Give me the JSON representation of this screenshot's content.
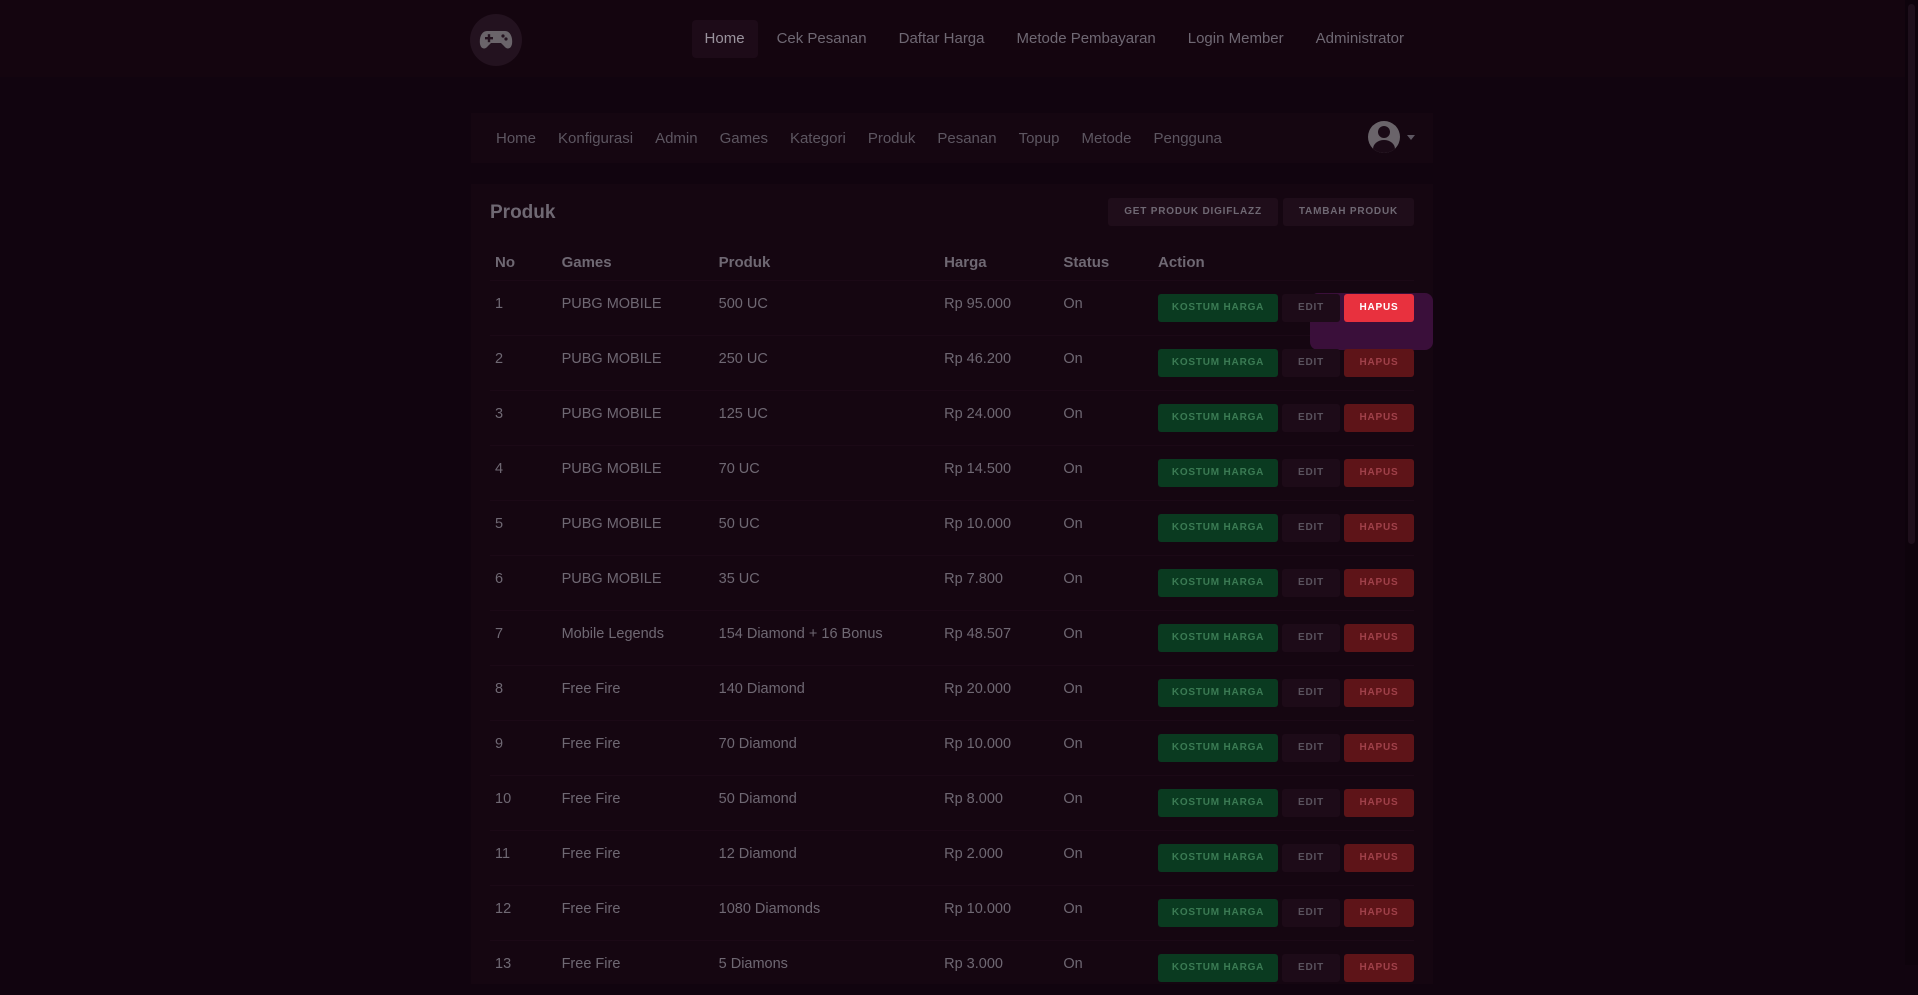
{
  "topnav": {
    "items": [
      "Home",
      "Cek Pesanan",
      "Daftar Harga",
      "Metode Pembayaran",
      "Login Member",
      "Administrator"
    ],
    "active": "Home"
  },
  "subnav": {
    "items": [
      "Home",
      "Konfigurasi",
      "Admin",
      "Games",
      "Kategori",
      "Produk",
      "Pesanan",
      "Topup",
      "Metode",
      "Pengguna"
    ]
  },
  "card": {
    "title": "Produk",
    "btn_get": "GET PRODUK DIGIFLAZZ",
    "btn_add": "TAMBAH PRODUK"
  },
  "table": {
    "headers": [
      "No",
      "Games",
      "Produk",
      "Harga",
      "Status",
      "Action"
    ],
    "action_labels": {
      "kostum": "KOSTUM HARGA",
      "edit": "EDIT",
      "hapus": "HAPUS"
    },
    "rows": [
      {
        "no": "1",
        "game": "PUBG MOBILE",
        "produk": "500 UC",
        "harga": "Rp 95.000",
        "status": "On"
      },
      {
        "no": "2",
        "game": "PUBG MOBILE",
        "produk": "250 UC",
        "harga": "Rp 46.200",
        "status": "On"
      },
      {
        "no": "3",
        "game": "PUBG MOBILE",
        "produk": "125 UC",
        "harga": "Rp 24.000",
        "status": "On"
      },
      {
        "no": "4",
        "game": "PUBG MOBILE",
        "produk": "70 UC",
        "harga": "Rp 14.500",
        "status": "On"
      },
      {
        "no": "5",
        "game": "PUBG MOBILE",
        "produk": "50 UC",
        "harga": "Rp 10.000",
        "status": "On"
      },
      {
        "no": "6",
        "game": "PUBG MOBILE",
        "produk": "35 UC",
        "harga": "Rp 7.800",
        "status": "On"
      },
      {
        "no": "7",
        "game": "Mobile Legends",
        "produk": "154 Diamond + 16 Bonus",
        "harga": "Rp 48.507",
        "status": "On"
      },
      {
        "no": "8",
        "game": "Free Fire",
        "produk": "140 Diamond",
        "harga": "Rp 20.000",
        "status": "On"
      },
      {
        "no": "9",
        "game": "Free Fire",
        "produk": "70 Diamond",
        "harga": "Rp 10.000",
        "status": "On"
      },
      {
        "no": "10",
        "game": "Free Fire",
        "produk": "50 Diamond",
        "harga": "Rp 8.000",
        "status": "On"
      },
      {
        "no": "11",
        "game": "Free Fire",
        "produk": "12 Diamond",
        "harga": "Rp 2.000",
        "status": "On"
      },
      {
        "no": "12",
        "game": "Free Fire",
        "produk": "1080 Diamonds",
        "harga": "Rp 10.000",
        "status": "On"
      },
      {
        "no": "13",
        "game": "Free Fire",
        "produk": "5 Diamons",
        "harga": "Rp 3.000",
        "status": "On"
      }
    ]
  },
  "icons": {
    "logo": "gamepad-icon",
    "avatar": "user-avatar-icon",
    "caret": "caret-down-icon"
  },
  "colors": {
    "background": "#11040f",
    "accent_red": "#e8313e",
    "accent_green": "#0a3a20"
  }
}
